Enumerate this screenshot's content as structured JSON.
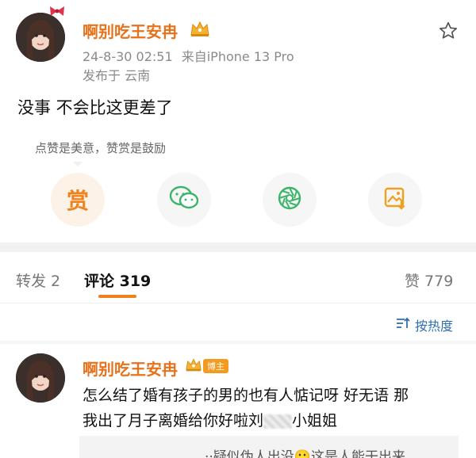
{
  "post": {
    "author": "啊别吃王安冉",
    "timestamp": "24-8-30 02:51",
    "source": "来自iPhone 13 Pro",
    "location": "发布于 云南",
    "text": "没事 不会比这更差了"
  },
  "reward": {
    "tip": "点赞是美意，赞赏是鼓励",
    "reward_glyph": "赏"
  },
  "tabs": {
    "repost": "转发 2",
    "comments": "评论 319",
    "likes": "赞 779"
  },
  "sort": {
    "label": "按热度"
  },
  "comment": {
    "author": "啊别吃王安冉",
    "badge": "博主",
    "line1": "怎么结了婚有孩子的男的也有人惦记呀 好无语 那",
    "line2": "我出了月子离婚给你好啦刘",
    "line2_end": "小姐姐",
    "quote": "··疑似伪人出没🙂这是人能干出来"
  },
  "colors": {
    "username": "#e8721c",
    "active_tab_underline": "#f0821e",
    "sort_link": "#2f6fb3",
    "reward_orange": "#f0821e",
    "wechat_green": "#3cb56b"
  },
  "icons": [
    "star-icon",
    "crown-icon",
    "reward-icon",
    "wechat-icon",
    "moments-icon",
    "save-image-icon",
    "sort-icon"
  ]
}
